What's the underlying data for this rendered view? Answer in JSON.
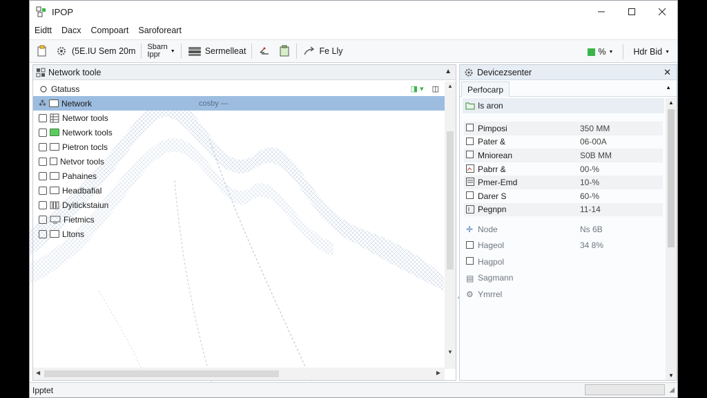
{
  "window": {
    "title": "IPOP",
    "controls": {
      "minimize": "—",
      "maximize": "☐",
      "close": "✕"
    }
  },
  "menu": [
    "Eidtt",
    "Dacx",
    "Compoart",
    "Saroforeart"
  ],
  "toolbar": {
    "btn1_label": "(5E.IU Sem 20m",
    "btn2_line1": "Sbarn",
    "btn2_line2": "Ippr",
    "btn3_label": "Sermelleat",
    "btn4_label": "Fe Lly",
    "right_percent": "%",
    "right_menu": "Hdr Bid"
  },
  "left_panel": {
    "title": "Network toole",
    "items": [
      {
        "label": "Gtatuss",
        "icon": "status-icon"
      },
      {
        "label": "Network",
        "icon": "folder-icon",
        "selected": true,
        "hint": "cosby —"
      },
      {
        "label": "Networ tools",
        "icon": "grid-icon"
      },
      {
        "label": "Network tools",
        "icon": "green-folder-icon"
      },
      {
        "label": "Pietron tocls",
        "icon": "folder-icon"
      },
      {
        "label": "Netvor tools",
        "icon": "document-icon"
      },
      {
        "label": "Pahaines",
        "icon": "folder-icon"
      },
      {
        "label": "Headbafial",
        "icon": "folder-icon"
      },
      {
        "label": "Dyitickstaiun",
        "icon": "bars-icon"
      },
      {
        "label": "Fietmics",
        "icon": "monitor-icon"
      },
      {
        "label": "Lltons",
        "icon": "folder-icon"
      }
    ]
  },
  "right_panel": {
    "title": "Devicezsenter",
    "tab": "Perfocarp",
    "section": "Is aron",
    "properties": [
      {
        "name": "Pimposi",
        "value": "350 MM"
      },
      {
        "name": "Pater &",
        "value": "06-00A"
      },
      {
        "name": "Mniorean",
        "value": "S0B MM"
      },
      {
        "name": "Pabrr &",
        "value": "00-%"
      },
      {
        "name": "Pmer-Emd",
        "value": "10-%"
      },
      {
        "name": "Darer S",
        "value": "60-%"
      },
      {
        "name": "Pegnpn",
        "value": "11-14"
      }
    ],
    "faded": [
      {
        "name": "Node",
        "value": "Ns 6B"
      },
      {
        "name": "Hageol",
        "value": "34 8% "
      },
      {
        "name": "Hagpol",
        "value": ""
      },
      {
        "name": "Sagmann",
        "value": ""
      },
      {
        "name": "Ymrrel",
        "value": ""
      }
    ]
  },
  "status": {
    "text": "Ipptet",
    "progress_fraction": 0.0
  }
}
